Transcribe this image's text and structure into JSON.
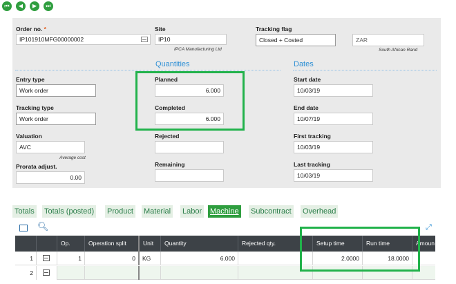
{
  "nav": {
    "icons": [
      "first-icon",
      "previous-icon",
      "next-icon",
      "last-icon"
    ],
    "color": "#2f9e3f"
  },
  "header": {
    "order_no": {
      "label": "Order no.",
      "required_mark": "*",
      "value": "IP101910MFG00000002"
    },
    "site": {
      "label": "Site",
      "value": "IP10",
      "description": "IPCA Manufacturing Ltd"
    },
    "tracking_flag": {
      "label": "Tracking flag",
      "value": "Closed + Costed"
    },
    "currency": {
      "value": "ZAR",
      "description": "South African Rand"
    },
    "entry_type": {
      "label": "Entry type",
      "value": "Work order"
    },
    "tracking_type": {
      "label": "Tracking type",
      "value": "Work order"
    },
    "valuation": {
      "label": "Valuation",
      "value": "AVC",
      "description": "Average cost"
    },
    "prorata": {
      "label": "Prorata adjust.",
      "value": "0.00"
    }
  },
  "quantities": {
    "title": "Quantities",
    "planned": {
      "label": "Planned",
      "value": "6.000"
    },
    "completed": {
      "label": "Completed",
      "value": "6.000"
    },
    "rejected": {
      "label": "Rejected",
      "value": ""
    },
    "remaining": {
      "label": "Remaining",
      "value": ""
    }
  },
  "dates": {
    "title": "Dates",
    "start": {
      "label": "Start date",
      "value": "10/03/19"
    },
    "end": {
      "label": "End date",
      "value": "10/07/19"
    },
    "first_tracking": {
      "label": "First tracking",
      "value": "10/03/19"
    },
    "last_tracking": {
      "label": "Last tracking",
      "value": "10/03/19"
    }
  },
  "tabs": [
    "Totals",
    "Totals (posted)",
    "Product",
    "Material",
    "Labor",
    "Machine",
    "Subcontract",
    "Overhead"
  ],
  "active_tab": "Machine",
  "grid": {
    "toolbar_icons": [
      "grid-options-icon",
      "search-icon",
      "expand-icon"
    ],
    "columns": [
      "",
      "",
      "Op.",
      "Operation split",
      "Unit",
      "Quantity",
      "Rejected qty.",
      "Setup time",
      "Run time",
      "Amoun"
    ],
    "rows": [
      {
        "num": "1",
        "op": "1",
        "split": "0",
        "unit": "KG",
        "quantity": "6.000",
        "rejected": "",
        "setup": "2.0000",
        "run": "18.0000",
        "amount": ""
      },
      {
        "num": "2",
        "op": "",
        "split": "",
        "unit": "",
        "quantity": "",
        "rejected": "",
        "setup": "",
        "run": "",
        "amount": ""
      }
    ]
  },
  "colors": {
    "highlight": "#21b24b",
    "section": "#2d8fd5",
    "header_bar": "#3d4247"
  }
}
